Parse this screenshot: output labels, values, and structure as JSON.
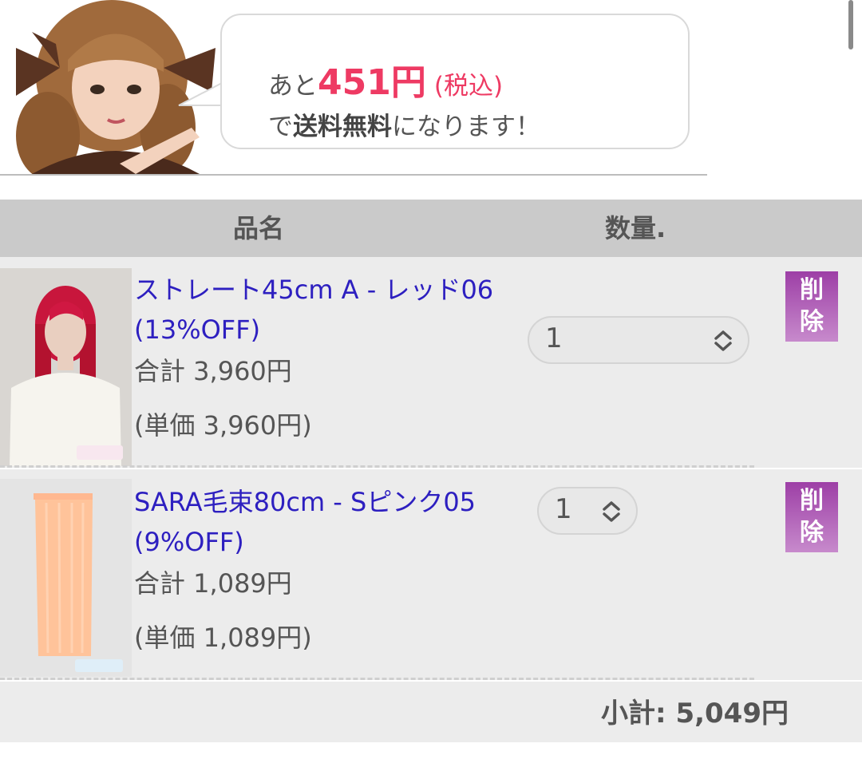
{
  "banner": {
    "prefix": "あと",
    "amount": "451円",
    "tax_note": "(税込)",
    "line2_prefix": "で",
    "line2_bold": "送料無料",
    "line2_suffix": "になります！"
  },
  "table": {
    "headers": {
      "name": "品名",
      "quantity": "数量."
    }
  },
  "items": [
    {
      "title": "ストレート45cm A - レッド06 (13%OFF)",
      "total": "合計 3,960円",
      "unit_price": "(単価 3,960円)",
      "quantity": "1",
      "delete_label": "削除",
      "thumb_color": "#c8163c"
    },
    {
      "title": "SARA毛束80cm - Sピンク05 (9%OFF)",
      "total": "合計 1,089円",
      "unit_price": "(単価 1,089円)",
      "quantity": "1",
      "delete_label": "削除",
      "thumb_color": "#ffc39a"
    }
  ],
  "subtotal": "小計: 5,049円",
  "colors": {
    "accent": "#ee3a63",
    "link": "#2d1fc0",
    "delete_button": "#9d3fa6"
  }
}
